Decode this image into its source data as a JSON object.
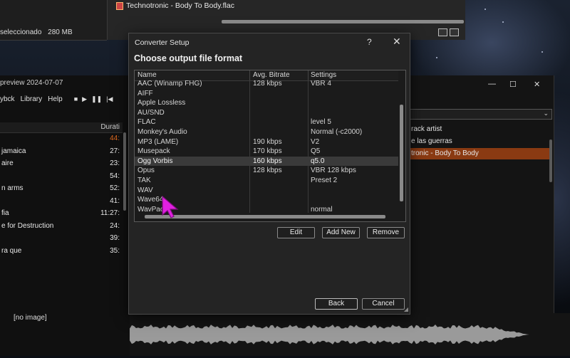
{
  "top_window": {
    "status_text": "seleccionado",
    "status_size": "280 MB",
    "file_name": "Technotronic - Body To Body.flac"
  },
  "player_window": {
    "title": "preview 2024-07-07",
    "menu": [
      "ybck",
      "Library",
      "Help"
    ],
    "duration_header": "Durati",
    "playlist": [
      {
        "title": "",
        "duration": "44:",
        "highlight": true
      },
      {
        "title": "jamaica",
        "duration": "27:"
      },
      {
        "title": "aire",
        "duration": "23:"
      },
      {
        "title": "",
        "duration": "54:"
      },
      {
        "title": "n arms",
        "duration": "52:"
      },
      {
        "title": "",
        "duration": "41:"
      },
      {
        "title": "fia",
        "duration": "11:27:"
      },
      {
        "title": "e for Destruction",
        "duration": "24:"
      },
      {
        "title": "",
        "duration": "39:"
      },
      {
        "title": "ra que",
        "duration": "35:"
      }
    ],
    "no_image": "[no image]"
  },
  "right_window": {
    "rows": [
      {
        "text": "rack artist",
        "selected": false
      },
      {
        "text": "e las guerras",
        "selected": false
      },
      {
        "text": "tronic - Body To Body",
        "selected": true
      }
    ]
  },
  "dialog": {
    "title": "Converter Setup",
    "help": "?",
    "close": "✕",
    "heading": "Choose output file format",
    "columns": {
      "name": "Name",
      "bitrate": "Avg. Bitrate",
      "settings": "Settings"
    },
    "formats": [
      {
        "name": "AAC (Winamp FHG)",
        "bitrate": "128 kbps",
        "settings": "VBR 4"
      },
      {
        "name": "AIFF",
        "bitrate": "",
        "settings": ""
      },
      {
        "name": "Apple Lossless",
        "bitrate": "",
        "settings": ""
      },
      {
        "name": "AU/SND",
        "bitrate": "",
        "settings": ""
      },
      {
        "name": "FLAC",
        "bitrate": "",
        "settings": "level 5"
      },
      {
        "name": "Monkey's Audio",
        "bitrate": "",
        "settings": "Normal (-c2000)"
      },
      {
        "name": "MP3 (LAME)",
        "bitrate": "190 kbps",
        "settings": "V2"
      },
      {
        "name": "Musepack",
        "bitrate": "170 kbps",
        "settings": "Q5"
      },
      {
        "name": "Ogg Vorbis",
        "bitrate": "160 kbps",
        "settings": "q5.0",
        "selected": true
      },
      {
        "name": "Opus",
        "bitrate": "128 kbps",
        "settings": "VBR 128 kbps"
      },
      {
        "name": "TAK",
        "bitrate": "",
        "settings": "Preset 2"
      },
      {
        "name": "WAV",
        "bitrate": "",
        "settings": ""
      },
      {
        "name": "Wave64",
        "bitrate": "",
        "settings": ""
      },
      {
        "name": "WavPack",
        "bitrate": "",
        "settings": "normal"
      }
    ],
    "buttons": {
      "edit": "Edit",
      "add_new": "Add New",
      "remove": "Remove",
      "back": "Back",
      "cancel": "Cancel"
    }
  },
  "colors": {
    "accent": "#e06a1e",
    "selection": "#8a3a12",
    "cursor": "#e020e0"
  }
}
